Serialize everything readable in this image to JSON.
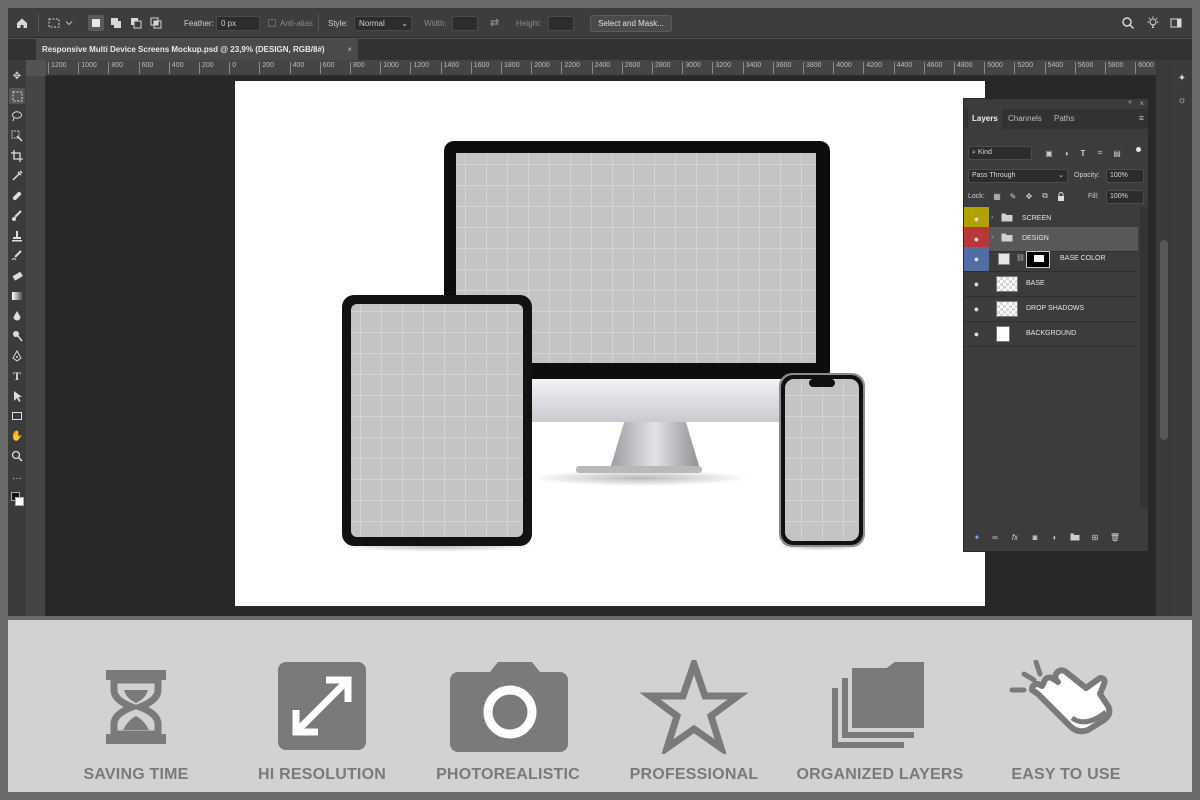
{
  "options_bar": {
    "feather_label": "Feather:",
    "feather_value": "0 px",
    "anti_alias_label": "Anti-alias",
    "style_label": "Style:",
    "style_value": "Normal",
    "width_label": "Width:",
    "height_label": "Height:",
    "select_mask_label": "Select and Mask..."
  },
  "document_tab": {
    "title": "Responsive Multi Device Screens Mockup.psd @ 23,9% (DESIGN, RGB/8#)",
    "close": "×"
  },
  "ruler": {
    "labels": [
      "1200",
      "1000",
      "800",
      "600",
      "400",
      "200",
      "0",
      "200",
      "400",
      "600",
      "800",
      "1000",
      "1200",
      "1400",
      "1600",
      "1800",
      "2000",
      "2200",
      "2400",
      "2600",
      "2800",
      "3000",
      "3200",
      "3400",
      "3600",
      "3800",
      "4000",
      "4200",
      "4400",
      "4600",
      "4800",
      "5000",
      "5200",
      "5400",
      "5600",
      "5800",
      "6000"
    ]
  },
  "layers_panel": {
    "tabs": [
      "Layers",
      "Channels",
      "Paths"
    ],
    "filter_value": "Kind",
    "blend_mode": "Pass Through",
    "opacity_label": "Opacity:",
    "opacity_value": "100%",
    "lock_label": "Lock:",
    "fill_label": "Fill:",
    "fill_value": "100%",
    "layers": [
      {
        "name": "SCREEN",
        "color": "#b3a100",
        "type": "group"
      },
      {
        "name": "DESIGN",
        "color": "#b8383a",
        "type": "group",
        "selected": true
      },
      {
        "name": "BASE COLOR",
        "color": "#4f6ea3",
        "type": "adjustment"
      },
      {
        "name": "BASE",
        "color": "",
        "type": "pixel"
      },
      {
        "name": "DROP SHADOWS",
        "color": "",
        "type": "pixel"
      },
      {
        "name": "BACKGROUND",
        "color": "",
        "type": "pixel"
      }
    ]
  },
  "features": [
    {
      "label": "SAVING TIME",
      "icon": "hourglass-icon"
    },
    {
      "label": "HI RESOLUTION",
      "icon": "expand-arrows-icon"
    },
    {
      "label": "PHOTOREALISTIC",
      "icon": "camera-icon"
    },
    {
      "label": "PROFESSIONAL",
      "icon": "star-icon"
    },
    {
      "label": "ORGANIZED LAYERS",
      "icon": "stacked-folders-icon"
    },
    {
      "label": "EASY TO USE",
      "icon": "pointing-hand-icon"
    }
  ],
  "colors": {
    "feature_icon": "#7a7a7a",
    "feature_band": "#d2d2d2",
    "app_chrome": "#3d3d3d"
  }
}
